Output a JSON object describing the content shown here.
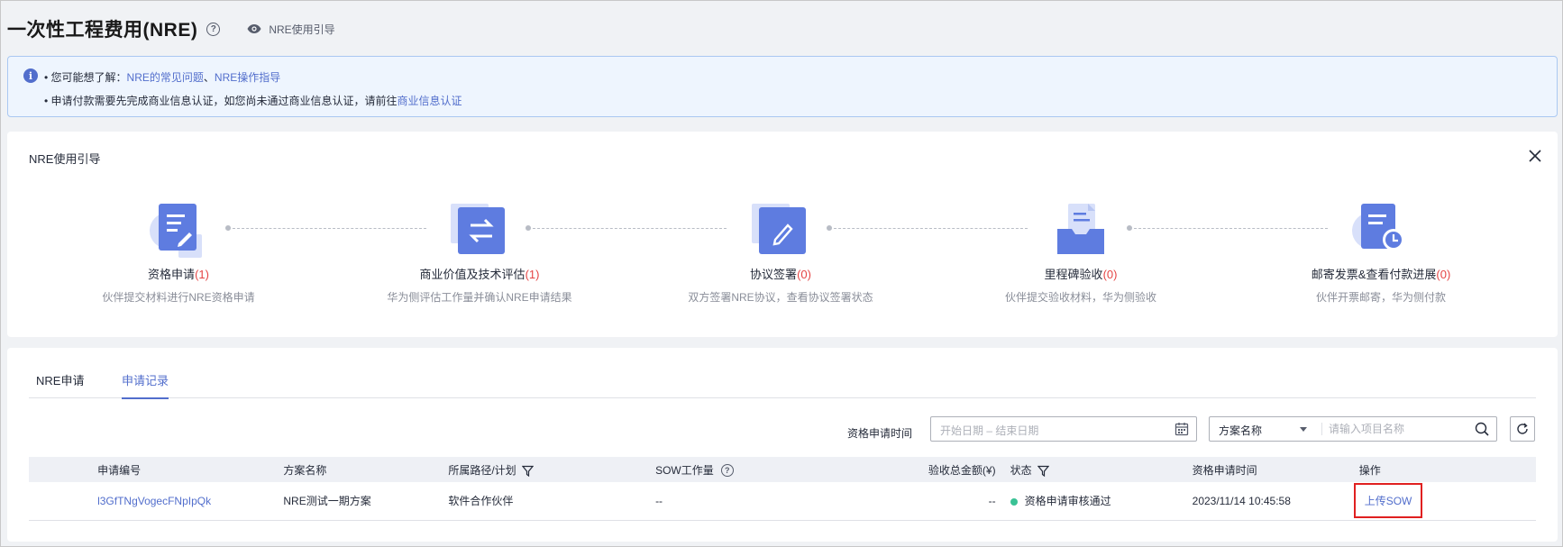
{
  "page": {
    "title": "一次性工程费用(NRE)",
    "guide_link": "NRE使用引导"
  },
  "notice": {
    "line1_prefix": "• 您可能想了解：",
    "line1_link1": "NRE的常见问题",
    "line1_sep": "、",
    "line1_link2": "NRE操作指导",
    "line2_prefix": "• 申请付款需要先完成商业信息认证，如您尚未通过商业信息认证，请前往",
    "line2_link": "商业信息认证"
  },
  "guide": {
    "title": "NRE使用引导",
    "steps": [
      {
        "name": "资格申请",
        "count": "(1)",
        "desc": "伙伴提交材料进行NRE资格申请",
        "icon": "document-edit-icon"
      },
      {
        "name": "商业价值及技术评估",
        "count": "(1)",
        "desc": "华为侧评估工作量并确认NRE申请结果",
        "icon": "exchange-arrows-icon"
      },
      {
        "name": "协议签署",
        "count": "(0)",
        "desc": "双方签署NRE协议，查看协议签署状态",
        "icon": "pen-sign-icon"
      },
      {
        "name": "里程碑验收",
        "count": "(0)",
        "desc": "伙伴提交验收材料，华为侧验收",
        "icon": "inbox-document-icon"
      },
      {
        "name": "邮寄发票&查看付款进展",
        "count": "(0)",
        "desc": "伙伴开票邮寄，华为侧付款",
        "icon": "document-clock-icon"
      }
    ]
  },
  "tabs": [
    {
      "label": "NRE申请",
      "active": false
    },
    {
      "label": "申请记录",
      "active": true
    }
  ],
  "filters": {
    "date_label": "资格申请时间",
    "date_placeholder": "开始日期 – 结束日期",
    "select_value": "方案名称",
    "search_placeholder": "请输入项目名称"
  },
  "table": {
    "columns": [
      "申请编号",
      "方案名称",
      "所属路径/计划",
      "SOW工作量",
      "验收总金额(¥)",
      "状态",
      "资格申请时间",
      "操作"
    ],
    "rows": [
      {
        "id": "l3GfTNgVogecFNpIpQk",
        "scheme": "NRE测试一期方案",
        "path": "软件合作伙伴",
        "sow": "--",
        "amount": "--",
        "status": "资格申请审核通过",
        "time": "2023/11/14 10:45:58",
        "action": "上传SOW"
      }
    ]
  },
  "colors": {
    "accent": "#526ecc",
    "status_success": "#3ac295",
    "count_red": "#e54545",
    "highlight_border": "#e02020"
  }
}
